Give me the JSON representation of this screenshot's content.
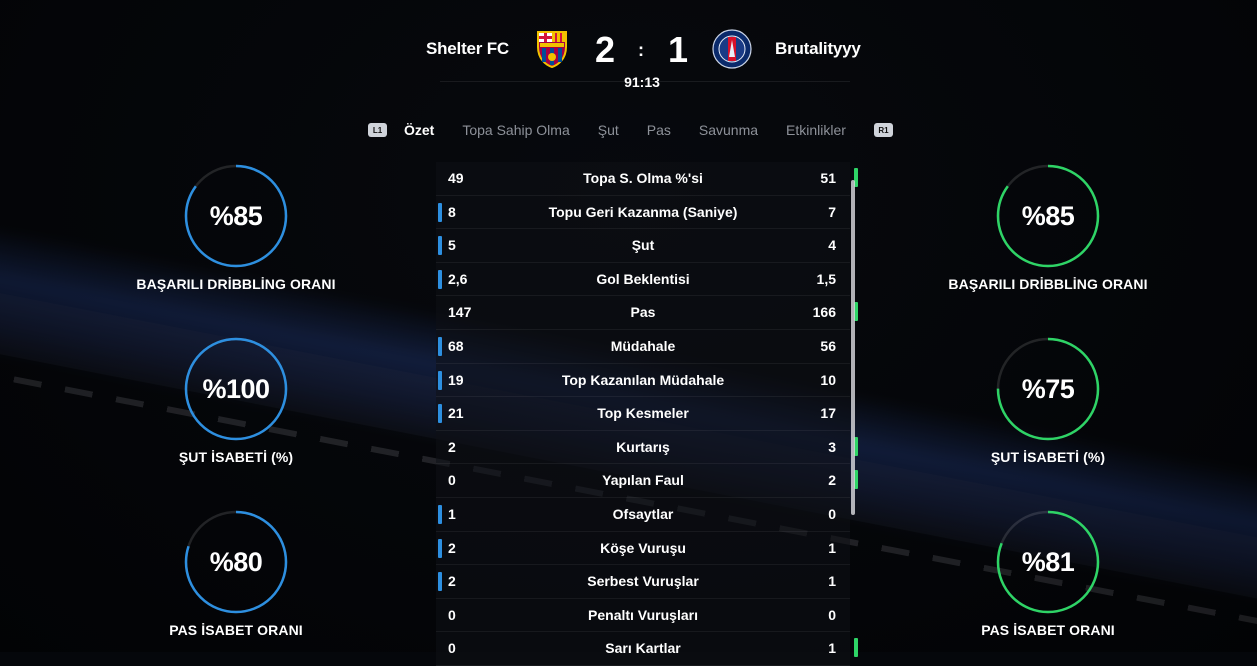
{
  "match": {
    "home_name": "Shelter FC",
    "away_name": "Brutalityyy",
    "home_score": "2",
    "away_score": "1",
    "separator": ":",
    "clock": "91:13"
  },
  "tabs": {
    "left_hint": "L1",
    "right_hint": "R1",
    "items": [
      "Özet",
      "Topa Sahip Olma",
      "Şut",
      "Pas",
      "Savunma",
      "Etkinlikler"
    ],
    "active_index": 0
  },
  "colors": {
    "home_accent": "#2d8fe0",
    "away_accent": "#2ed466"
  },
  "home_circles": [
    {
      "value": "%85",
      "label": "BAŞARILI DRİBBLİNG ORANI",
      "fraction": 0.85
    },
    {
      "value": "%100",
      "label": "ŞUT İSABETİ (%)",
      "fraction": 1.0
    },
    {
      "value": "%80",
      "label": "PAS İSABET ORANI",
      "fraction": 0.8
    }
  ],
  "away_circles": [
    {
      "value": "%85",
      "label": "BAŞARILI DRİBBLİNG ORANI",
      "fraction": 0.85
    },
    {
      "value": "%75",
      "label": "ŞUT İSABETİ (%)",
      "fraction": 0.75
    },
    {
      "value": "%81",
      "label": "PAS İSABET ORANI",
      "fraction": 0.81
    }
  ],
  "stats": [
    {
      "home": "49",
      "name": "Topa S. Olma %'si",
      "away": "51",
      "leader": "away"
    },
    {
      "home": "8",
      "name": "Topu Geri Kazanma (Saniye)",
      "away": "7",
      "leader": "home"
    },
    {
      "home": "5",
      "name": "Şut",
      "away": "4",
      "leader": "home"
    },
    {
      "home": "2,6",
      "name": "Gol Beklentisi",
      "away": "1,5",
      "leader": "home"
    },
    {
      "home": "147",
      "name": "Pas",
      "away": "166",
      "leader": "away"
    },
    {
      "home": "68",
      "name": "Müdahale",
      "away": "56",
      "leader": "home"
    },
    {
      "home": "19",
      "name": "Top Kazanılan Müdahale",
      "away": "10",
      "leader": "home"
    },
    {
      "home": "21",
      "name": "Top Kesmeler",
      "away": "17",
      "leader": "home"
    },
    {
      "home": "2",
      "name": "Kurtarış",
      "away": "3",
      "leader": "away"
    },
    {
      "home": "0",
      "name": "Yapılan Faul",
      "away": "2",
      "leader": "away"
    },
    {
      "home": "1",
      "name": "Ofsaytlar",
      "away": "0",
      "leader": "home"
    },
    {
      "home": "2",
      "name": "Köşe Vuruşu",
      "away": "1",
      "leader": "home"
    },
    {
      "home": "2",
      "name": "Serbest Vuruşlar",
      "away": "1",
      "leader": "home"
    },
    {
      "home": "0",
      "name": "Penaltı Vuruşları",
      "away": "0",
      "leader": "none"
    },
    {
      "home": "0",
      "name": "Sarı Kartlar",
      "away": "1",
      "leader": "away"
    }
  ]
}
